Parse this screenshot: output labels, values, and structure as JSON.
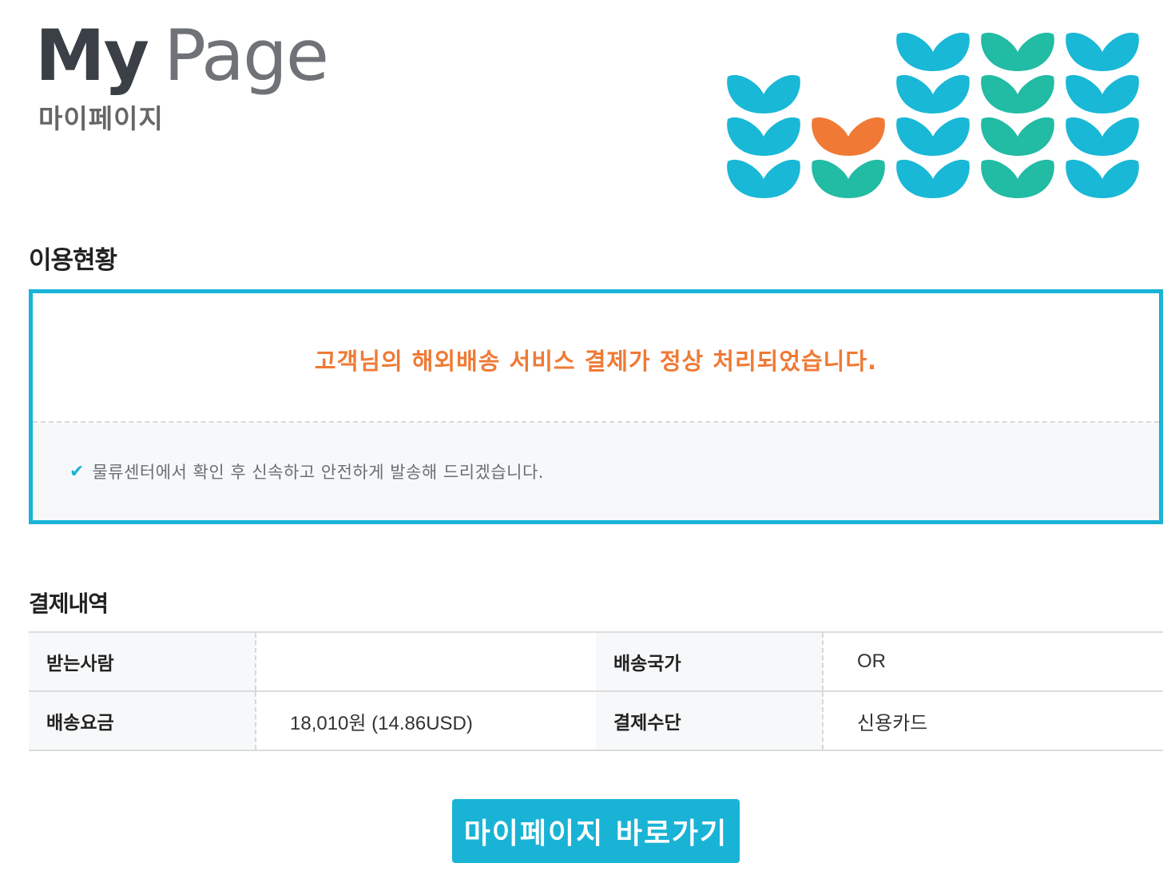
{
  "header": {
    "title_bold": "My",
    "title_light": "Page",
    "subtitle": "마이페이지"
  },
  "brand_pattern": {
    "icon": "leaf-pattern-icon",
    "colors": {
      "blue": "#19b8d6",
      "teal": "#22bba4",
      "orange": "#f07a35"
    }
  },
  "status": {
    "section_title": "이용현황",
    "message": "고객님의 해외배송 서비스 결제가 정상 처리되었습니다.",
    "note_icon": "checkmark-icon",
    "note": "물류센터에서 확인 후 신속하고 안전하게 발송해 드리겠습니다."
  },
  "payment": {
    "section_title": "결제내역",
    "rows": [
      {
        "label1": "받는사람",
        "value1": "",
        "label2": "배송국가",
        "value2": "OR"
      },
      {
        "label1": "배송요금",
        "value1": "18,010원 (14.86USD)",
        "label2": "결제수단",
        "value2": "신용카드"
      }
    ]
  },
  "cta": {
    "label": "마이페이지 바로가기"
  },
  "colors": {
    "accent": "#19b3d6",
    "highlight": "#ef7a35",
    "panel_bg": "#f7f8f9"
  }
}
